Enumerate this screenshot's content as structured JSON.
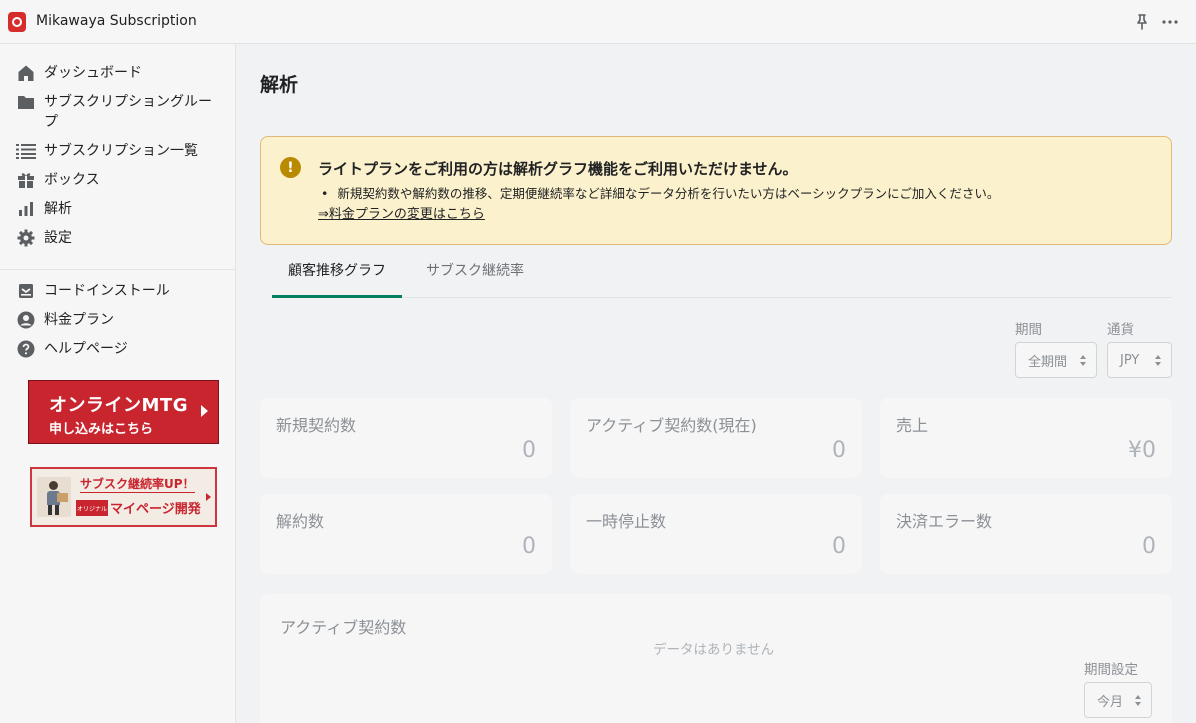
{
  "app": {
    "title": "Mikawaya Subscription"
  },
  "topbar": {
    "pin_icon": "pin-icon",
    "more_icon": "more-icon"
  },
  "sidebar": {
    "items": [
      {
        "label": "ダッシュボード",
        "icon": "home-icon"
      },
      {
        "label": "サブスクリプショングループ",
        "icon": "folder-icon"
      },
      {
        "label": "サブスクリプション一覧",
        "icon": "list-icon"
      },
      {
        "label": "ボックス",
        "icon": "gift-icon"
      },
      {
        "label": "解析",
        "icon": "analytics-icon"
      },
      {
        "label": "設定",
        "icon": "gear-icon"
      }
    ],
    "secondary": [
      {
        "label": "コードインストール",
        "icon": "install-icon"
      },
      {
        "label": "料金プラン",
        "icon": "user-icon"
      },
      {
        "label": "ヘルプページ",
        "icon": "help-icon"
      }
    ],
    "banner_meeting": {
      "line1": "オンラインMTG",
      "line2": "申し込みはこちら"
    },
    "banner_mypage": {
      "line1": "サブスク継続率UP！",
      "tag": "オリジナル",
      "line2": "マイページ開発"
    }
  },
  "main": {
    "title": "解析",
    "notice": {
      "title": "ライトプランをご利用の方は解析グラフ機能をご利用いただけません。",
      "bullet": "新規契約数や解約数の推移、定期便継続率など詳細なデータ分析を行いたい方はベーシックプランにご加入ください。",
      "link": "⇒料金プランの変更はこちら"
    },
    "tabs": [
      {
        "label": "顧客推移グラフ",
        "active": true
      },
      {
        "label": "サブスク継続率",
        "active": false
      }
    ],
    "filters": {
      "period": {
        "label": "期間",
        "value": "全期間"
      },
      "currency": {
        "label": "通貨",
        "value": "JPY"
      }
    },
    "stats": [
      {
        "label": "新規契約数",
        "value": "0"
      },
      {
        "label": "アクティブ契約数(現在)",
        "value": "0"
      },
      {
        "label": "売上",
        "value": "¥0"
      },
      {
        "label": "解約数",
        "value": "0"
      },
      {
        "label": "一時停止数",
        "value": "0"
      },
      {
        "label": "決済エラー数",
        "value": "0"
      }
    ],
    "panel": {
      "title": "アクティブ契約数",
      "empty": "データはありません",
      "period_label": "期間設定",
      "period_value": "今月"
    }
  },
  "colors": {
    "accent": "#008060",
    "brand": "#c8252f",
    "warning_bg": "#fcf1cd"
  }
}
